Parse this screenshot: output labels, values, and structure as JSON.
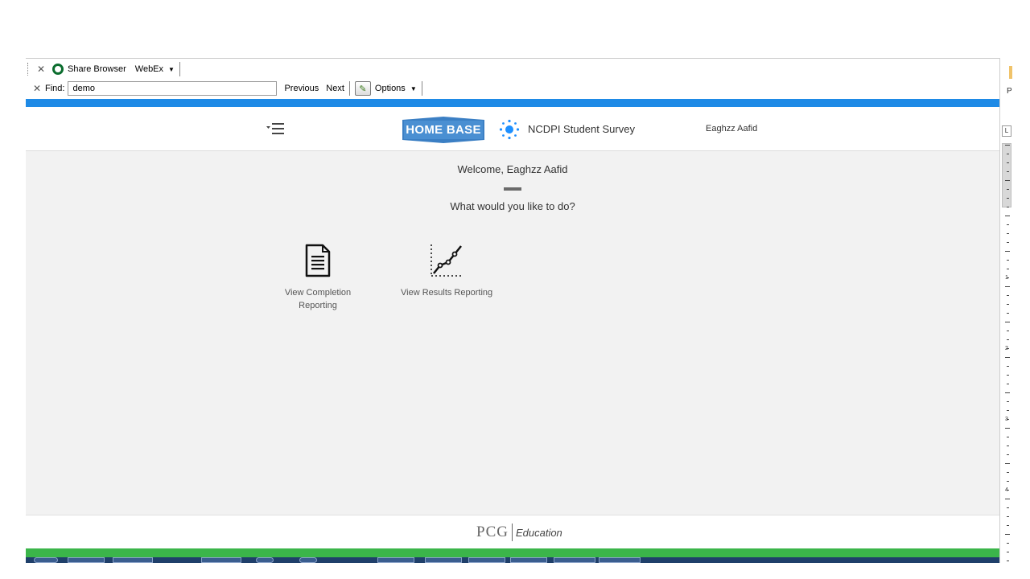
{
  "toolbar": {
    "share_browser_label": "Share Browser",
    "webex_label": "WebEx",
    "find_label": "Find:",
    "find_value": "demo",
    "previous_label": "Previous",
    "next_label": "Next",
    "options_label": "Options"
  },
  "header": {
    "logo_text": "HOME BASE",
    "survey_title": "NCDPI Student Survey",
    "user_name": "Eaghzz Aafid"
  },
  "main": {
    "welcome": "Welcome, Eaghzz Aafid",
    "question": "What would you like to do?",
    "tiles": [
      {
        "label_line1": "View Completion",
        "label_line2": "Reporting",
        "icon": "document-icon"
      },
      {
        "label_line1": "View Results Reporting",
        "label_line2": "",
        "icon": "line-chart-icon"
      }
    ]
  },
  "footer": {
    "pcg_mark": "PCG",
    "education": "Education"
  },
  "side": {
    "p_label": "P",
    "ruler_L": "L",
    "ruler_numbers": [
      "1",
      "2",
      "3",
      "4"
    ]
  },
  "colors": {
    "blue_bar": "#1e8ae6",
    "green_bar": "#3bb54a",
    "logo_blue": "#3b7fc4",
    "survey_icon_blue": "#1e90ff"
  }
}
